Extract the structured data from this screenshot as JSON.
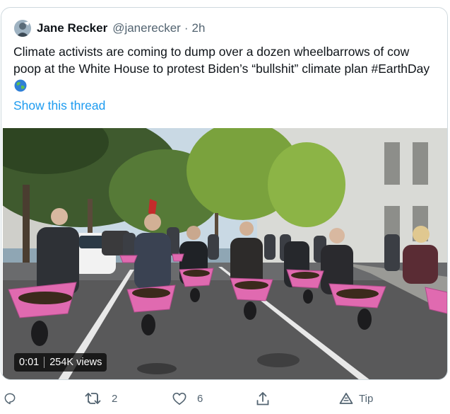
{
  "tweet": {
    "author_name": "Jane Recker",
    "handle": "@janerecker",
    "separator": "·",
    "time": "2h",
    "text_before_hashtag": "Climate activists are coming to dump over a dozen wheelbarrows of cow poop at the White House to protest Biden’s “bullshit” climate plan ",
    "hashtag": "#EarthDay",
    "show_thread": "Show this thread"
  },
  "video": {
    "timestamp": "0:01",
    "views": "254K views"
  },
  "actions": {
    "reply_count": "",
    "retweet_count": "2",
    "like_count": "6",
    "tip_label": "Tip"
  },
  "colors": {
    "link": "#1d9bf0",
    "text": "#0f1419",
    "secondary": "#536471",
    "border": "#cfd9de",
    "wheelbarrow": "#e06ab0"
  },
  "icons": [
    "avatar",
    "globe-emoji",
    "reply-icon",
    "retweet-icon",
    "like-icon",
    "share-icon",
    "tip-icon"
  ]
}
